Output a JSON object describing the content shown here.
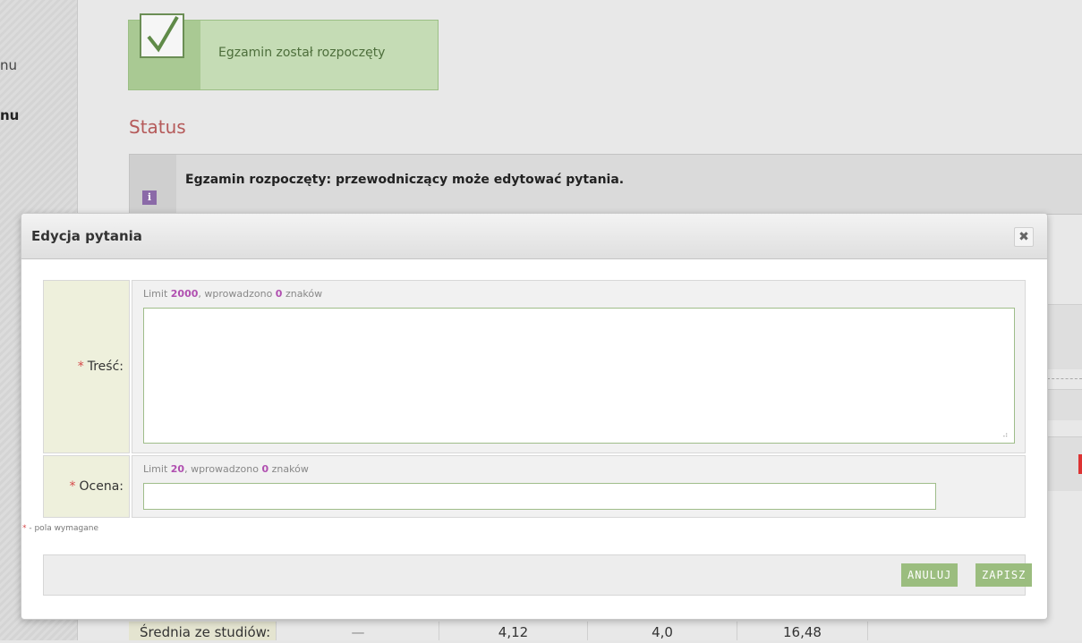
{
  "sidebar": {
    "items": [
      {
        "label": "nu"
      },
      {
        "label": "nu"
      }
    ]
  },
  "alert": {
    "message": "Egzamin został rozpoczęty"
  },
  "status": {
    "title": "Status",
    "info_text": "Egzamin rozpoczęty: przewodniczący może edytować pytania."
  },
  "averages": {
    "label": "Średnia ze studiów:",
    "values": [
      "—",
      "4,12",
      "4,0",
      "16,48"
    ]
  },
  "modal": {
    "title": "Edycja pytania",
    "close_icon": "close-icon",
    "fields": [
      {
        "label": "Treść:",
        "limit_prefix": "Limit ",
        "limit_value": "2000",
        "limit_middle": ", wprowadzono ",
        "entered_count": "0",
        "limit_suffix": " znaków",
        "value": ""
      },
      {
        "label": "Ocena:",
        "limit_prefix": "Limit ",
        "limit_value": "20",
        "limit_middle": ", wprowadzono ",
        "entered_count": "0",
        "limit_suffix": " znaków",
        "value": ""
      }
    ],
    "required_marker": "*",
    "required_note": " - pola wymagane",
    "buttons": {
      "cancel": "ANULUJ",
      "save": "ZAPISZ"
    }
  },
  "colors": {
    "accent_green": "#9bbd7f",
    "required_red": "#d64a4a",
    "limit_purple": "#b04fb0",
    "status_title": "#b55a5a"
  }
}
